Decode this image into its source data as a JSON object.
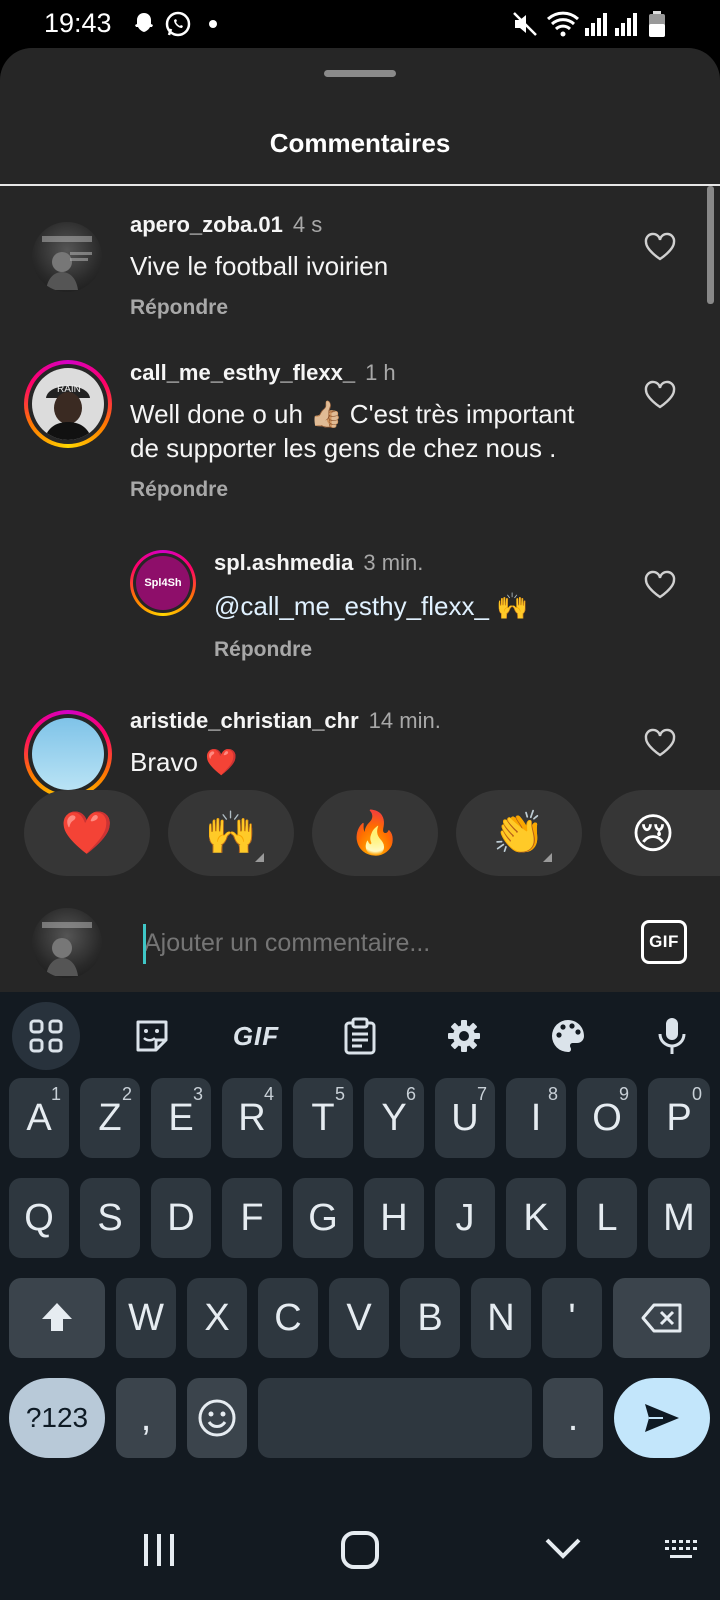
{
  "status_bar": {
    "time": "19:43",
    "left_icons": [
      "snapchat-icon",
      "whatsapp-icon",
      "dot-icon"
    ],
    "right_icons": [
      "mute-icon",
      "wifi-icon",
      "signal-icon",
      "signal-icon-2",
      "battery-icon"
    ]
  },
  "sheet": {
    "title": "Commentaires"
  },
  "comments": [
    {
      "username": "apero_zoba.01",
      "time": "4 s",
      "text": "Vive le football ivoirien",
      "reply_label": "Répondre"
    },
    {
      "username": "call_me_esthy_flexx_",
      "time": "1 h",
      "text_line1": "Well done o uh 👍🏼 C'est très important",
      "text_line2": "de supporter  les gens de chez  nous .",
      "reply_label": "Répondre",
      "avatar_cap_text": "RAIN"
    },
    {
      "username": "spl.ashmedia",
      "time": "3 min.",
      "text": "@call_me_esthy_flexx_ 🙌",
      "reply_label": "Répondre",
      "avatar_text": "Spl4Sh"
    },
    {
      "username": "aristide_christian_chr",
      "time": "14 min.",
      "text": "Bravo ❤️"
    }
  ],
  "reactions": [
    "❤️",
    "🙌",
    "🔥",
    "👏",
    "😢"
  ],
  "comment_input": {
    "placeholder": "Ajouter un commentaire...",
    "gif_label": "GIF"
  },
  "keyboard": {
    "toolbar": {
      "gif_label": "GIF",
      "icons": [
        "apps-grid-icon",
        "sticker-icon",
        "gif-icon",
        "clipboard-icon",
        "settings-icon",
        "palette-icon",
        "microphone-icon"
      ]
    },
    "row1": [
      {
        "label": "A",
        "num": "1"
      },
      {
        "label": "Z",
        "num": "2"
      },
      {
        "label": "E",
        "num": "3"
      },
      {
        "label": "R",
        "num": "4"
      },
      {
        "label": "T",
        "num": "5"
      },
      {
        "label": "Y",
        "num": "6"
      },
      {
        "label": "U",
        "num": "7"
      },
      {
        "label": "I",
        "num": "8"
      },
      {
        "label": "O",
        "num": "9"
      },
      {
        "label": "P",
        "num": "0"
      }
    ],
    "row2": [
      "Q",
      "S",
      "D",
      "F",
      "G",
      "H",
      "J",
      "K",
      "L",
      "M"
    ],
    "row3": [
      "W",
      "X",
      "C",
      "V",
      "B",
      "N",
      "'"
    ],
    "symbols_label": "?123",
    "comma_label": ",",
    "period_label": "."
  },
  "navbar": {
    "icons": [
      "recents-icon",
      "home-icon",
      "back-down-icon",
      "keyboard-switch-icon"
    ]
  }
}
